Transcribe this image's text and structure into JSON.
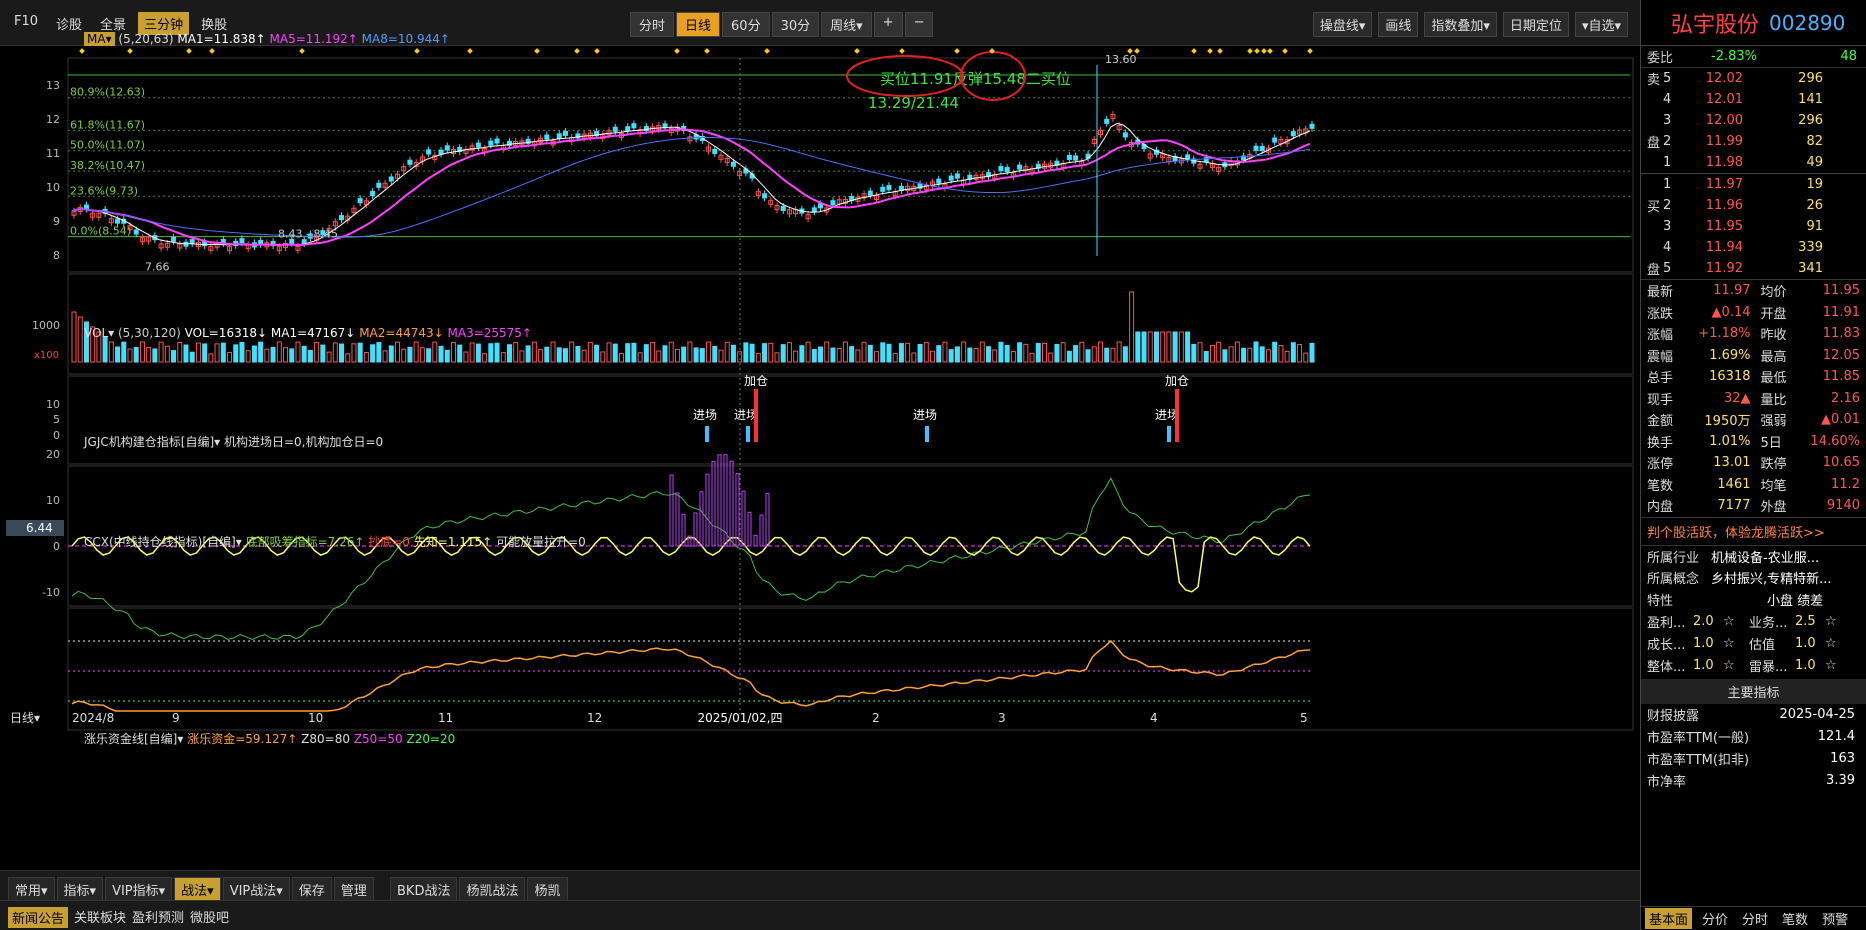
{
  "toolbar": {
    "left": [
      "F10",
      "诊股",
      "全景",
      "三分钟",
      "换股"
    ],
    "center": [
      "分时",
      "日线",
      "60分",
      "30分",
      "周线▾",
      "+",
      "−"
    ],
    "right": [
      "操盘线▾",
      "画线",
      "指数叠加▾",
      "日期定位",
      "▾自选▾"
    ]
  },
  "main": {
    "ma_label": "MA▾",
    "ma_params": "(5,20,63)",
    "ma1": "MA1=11.838↑",
    "ma5": "MA5=11.192↑",
    "ma8": "MA8=10.944↑",
    "fibs": [
      "80.9%(12.63)",
      "61.8%(11.67)",
      "50.0%(11.07)",
      "38.2%(10.47)",
      "23.6%(9.73)",
      "0.0%(8.54)"
    ],
    "y_ticks": [
      "13",
      "12",
      "11",
      "10",
      "9",
      "8"
    ],
    "annot1": "买位11.91反弹15.48二买位",
    "annot2": "13.29/21.44",
    "peak": "13.60",
    "low": "7.66",
    "range": "8.43 - 8.45"
  },
  "vol": {
    "title": "VOL▾",
    "params": "(5,30,120)",
    "vol": "VOL=16318↓",
    "ma1": "MA1=47167↓",
    "ma2": "MA2=44743↓",
    "ma3": "MA3=25575↑",
    "y_tick": "1000",
    "unit": "x100"
  },
  "jgjc": {
    "title": "JGJC机构建仓指标[自编]▾",
    "text": "机构进场日=0,机构加仓日=0",
    "y_ticks": [
      "10",
      "5",
      "0"
    ],
    "labels": [
      "进场",
      "进场",
      "加仓",
      "进场",
      "进场",
      "加仓"
    ]
  },
  "ccx": {
    "title": "CCX(中线持仓线指标)[自编]▾",
    "a": "底部吸筹指标=7.26↑",
    "b": "抄底=0",
    "c": "先知=1.115↑",
    "d": "可能放量拉升=0",
    "y_ticks": [
      "20",
      "10",
      "0",
      "-10"
    ],
    "cursor": "6.44"
  },
  "zl": {
    "title": "涨乐资金线[自编]▾",
    "a": "涨乐资金=59.127↑",
    "b": "Z80=80",
    "c": "Z50=50",
    "d": "Z20=20"
  },
  "xaxis": {
    "label": "日线▾",
    "ticks": [
      "2024/8",
      "9",
      "10",
      "11",
      "12",
      "2025/01/02,四",
      "2",
      "3",
      "4",
      "5"
    ]
  },
  "bottom": {
    "left": [
      "常用▾",
      "指标▾",
      "VIP指标▾",
      "战法▾",
      "VIP战法▾",
      "保存",
      "管理"
    ],
    "right": [
      "BKD战法",
      "杨凯战法",
      "杨凯"
    ]
  },
  "news": [
    "新闻公告",
    "关联板块",
    "盈利预测",
    "微股吧"
  ],
  "right": {
    "name": "弘宇股份",
    "code": "002890",
    "weibi_k": "委比",
    "weibi": "-2.83%",
    "weibi_n": "48",
    "sell": [
      {
        "lv": "5",
        "p": "12.02",
        "v": "296"
      },
      {
        "lv": "4",
        "p": "12.01",
        "v": "141"
      },
      {
        "lv": "3",
        "p": "12.00",
        "v": "296"
      },
      {
        "lv": "2",
        "p": "11.99",
        "v": "82"
      },
      {
        "lv": "1",
        "p": "11.98",
        "v": "49"
      }
    ],
    "buy": [
      {
        "lv": "1",
        "p": "11.97",
        "v": "19"
      },
      {
        "lv": "2",
        "p": "11.96",
        "v": "26"
      },
      {
        "lv": "3",
        "p": "11.95",
        "v": "91"
      },
      {
        "lv": "4",
        "p": "11.94",
        "v": "339"
      },
      {
        "lv": "5",
        "p": "11.92",
        "v": "341"
      }
    ],
    "stats": [
      [
        "最新",
        "11.97",
        "均价",
        "11.95"
      ],
      [
        "涨跌",
        "▲0.14",
        "开盘",
        "11.91"
      ],
      [
        "涨幅",
        "+1.18%",
        "昨收",
        "11.83"
      ],
      [
        "震幅",
        "1.69%",
        "最高",
        "12.05"
      ],
      [
        "总手",
        "16318",
        "最低",
        "11.85"
      ],
      [
        "现手",
        "32▲",
        "量比",
        "2.16"
      ],
      [
        "金额",
        "1950万",
        "强弱",
        "▲0.01"
      ],
      [
        "换手",
        "1.01%",
        "5日",
        "14.60%"
      ],
      [
        "涨停",
        "13.01",
        "跌停",
        "10.65"
      ],
      [
        "笔数",
        "1461",
        "均笔",
        "11.2"
      ],
      [
        "内盘",
        "7177",
        "外盘",
        "9140"
      ]
    ],
    "promo": "判个股活跃，体验龙腾活跃>>",
    "industry_k": "所属行业",
    "industry": "机械设备-农业服...",
    "concept_k": "所属概念",
    "concept": "乡村振兴,专精特新...",
    "feature_k": "特性",
    "feature": "小盘  绩差",
    "ratings": [
      [
        "盈利...",
        "2.0",
        "业务...",
        "2.5"
      ],
      [
        "成长...",
        "1.0",
        "估值",
        "1.0"
      ],
      [
        "整体...",
        "1.0",
        "雷暴...",
        "1.0"
      ]
    ],
    "section": "主要指标",
    "indicators": [
      [
        "财报披露",
        "2025-04-25"
      ],
      [
        "市盈率TTM(一般)",
        "121.4"
      ],
      [
        "市盈率TTM(扣非)",
        "163"
      ],
      [
        "市净率",
        "3.39"
      ]
    ],
    "tabs": [
      "基本面",
      "分价",
      "分时",
      "笔数",
      "预警"
    ]
  }
}
